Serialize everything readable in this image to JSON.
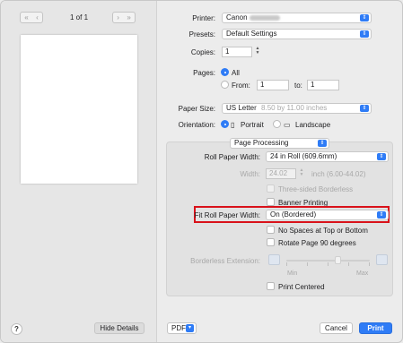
{
  "preview": {
    "page_indicator": "1 of 1",
    "first_icon": "«",
    "prev_icon": "‹",
    "next_icon": "›",
    "last_icon": "»"
  },
  "bottom": {
    "help": "?",
    "hide_details": "Hide Details",
    "pdf": "PDF",
    "cancel": "Cancel",
    "print": "Print"
  },
  "form": {
    "printer_label": "Printer:",
    "printer_value": "Canon",
    "presets_label": "Presets:",
    "presets_value": "Default Settings",
    "copies_label": "Copies:",
    "copies_value": "1",
    "pages_label": "Pages:",
    "pages_all": "All",
    "pages_from": "From:",
    "pages_from_value": "1",
    "pages_to": "to:",
    "pages_to_value": "1",
    "paper_size_label": "Paper Size:",
    "paper_size_value": "US Letter",
    "paper_size_dims": "8.50 by 11.00 inches",
    "orientation_label": "Orientation:",
    "portrait": "Portrait",
    "landscape": "Landscape",
    "section_value": "Page Processing"
  },
  "processing": {
    "roll_width_label": "Roll Paper Width:",
    "roll_width_value": "24 in Roll (609.6mm)",
    "width_label": "Width:",
    "width_value": "24.02",
    "width_unit": "inch (6.00-44.02)",
    "three_sided": "Three-sided Borderless",
    "banner": "Banner Printing",
    "fit_label": "Fit Roll Paper Width:",
    "fit_value": "On (Bordered)",
    "no_spaces": "No Spaces at Top or Bottom",
    "rotate": "Rotate Page 90 degrees",
    "borderless_ext_label": "Borderless Extension:",
    "min": "Min",
    "max": "Max",
    "print_centered": "Print Centered"
  },
  "colors": {
    "accent": "#2f7cf6",
    "highlight": "#d9121a"
  }
}
